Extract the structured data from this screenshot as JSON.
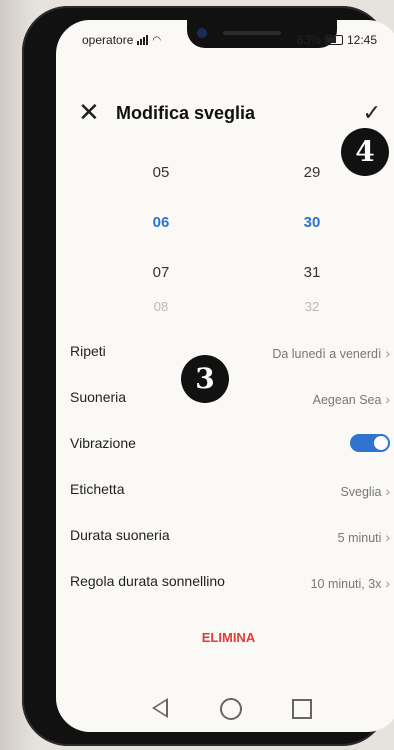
{
  "status_bar": {
    "carrier": "operatore",
    "battery": "63%",
    "time": "12:45"
  },
  "header": {
    "title": "Modifica sveglia",
    "close_icon": "close-icon",
    "confirm_icon": "check-icon"
  },
  "time_picker": {
    "hours": [
      "05",
      "06",
      "07",
      "08"
    ],
    "minutes": [
      "29",
      "30",
      "31",
      "32"
    ],
    "selected": {
      "hour": "06",
      "minute": "30"
    }
  },
  "settings": [
    {
      "label": "Ripeti",
      "value": "Da lunedì a venerdì"
    },
    {
      "label": "Suoneria",
      "value": "Aegean Sea"
    },
    {
      "label": "Vibrazione",
      "toggle_on": true
    },
    {
      "label": "Etichetta",
      "value": "Sveglia"
    },
    {
      "label": "Durata suoneria",
      "value": "5 minuti"
    },
    {
      "label": "Regola durata sonnellino",
      "value": "10 minuti, 3x"
    }
  ],
  "delete_label": "ELIMINA",
  "annotations": {
    "badge_a": "4",
    "badge_b": "3"
  },
  "colors": {
    "accent": "#2f74d0",
    "delete": "#e23b3b"
  }
}
